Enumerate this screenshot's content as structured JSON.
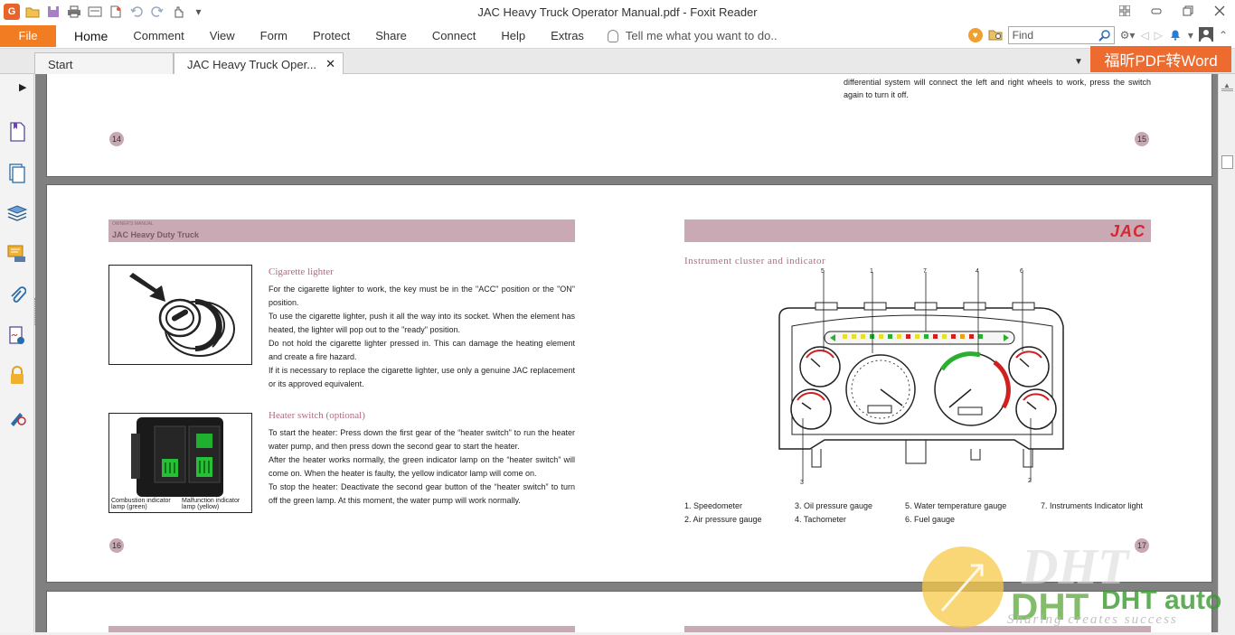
{
  "window": {
    "title": "JAC Heavy Truck Operator Manual.pdf - Foxit Reader",
    "app_logo": "G"
  },
  "menu": {
    "file": "File",
    "items": [
      "Home",
      "Comment",
      "View",
      "Form",
      "Protect",
      "Share",
      "Connect",
      "Help",
      "Extras"
    ],
    "tell_me": "Tell me what you want to do.."
  },
  "search": {
    "placeholder": "Find"
  },
  "tabs": [
    {
      "label": "Start"
    },
    {
      "label": "JAC Heavy Truck Oper..."
    }
  ],
  "promo": "福昕PDF转Word",
  "page_top": {
    "text": "differential system will connect the left and right wheels to work, press the switch again to turn it off.",
    "left_num": "14",
    "right_num": "15"
  },
  "page_main": {
    "header_small": "OWNER'S MANUAL",
    "header_title": "JAC Heavy Duty Truck",
    "brand": "JAC",
    "left_num": "16",
    "right_num": "17",
    "cigarette": {
      "title": "Cigarette lighter",
      "paragraphs": [
        "For the cigarette lighter to work, the key must be in the \"ACC\" position or the \"ON\" position.",
        "To use the cigarette lighter, push it all the way into its socket. When the element has heated, the lighter will pop out to the \"ready\" position.",
        "Do not hold the cigarette lighter pressed in. This can damage the heating element and create a fire hazard.",
        "If it is necessary to replace the cigarette lighter, use only a genuine JAC replacement or its approved equivalent."
      ]
    },
    "heater": {
      "title": "Heater switch (optional)",
      "caption_left": "Combustion indicator lamp (green)",
      "caption_right": "Malfunction indicator lamp (yellow)",
      "paragraphs": [
        "To start the heater: Press down the first gear of the “heater switch” to run the heater water pump, and then press down the second gear to start the heater.",
        "After the heater works normally, the green indicator lamp on the “heater switch” will come on. When the heater is faulty, the yellow indicator lamp will come on.",
        "To stop the heater: Deactivate the second gear button of the “heater switch” to turn off the green lamp. At this moment, the water pump will work normally."
      ]
    },
    "instrument": {
      "title": "Instrument cluster and indicator",
      "callouts": [
        "5",
        "1",
        "7",
        "4",
        "6",
        "3",
        "2"
      ],
      "legend": [
        "1. Speedometer",
        "2. Air pressure gauge",
        "3. Oil pressure gauge",
        "4. Tachometer",
        "5. Water temperature gauge",
        "6. Fuel gauge",
        "7. Instruments Indicator light"
      ]
    }
  },
  "watermark": {
    "text": "DHT auto",
    "tagline": "Sharing creates success"
  },
  "colors": {
    "accent": "#f27c22",
    "promo": "#ee6b2f",
    "band": "#c8a9b4",
    "brand": "#d7262f"
  }
}
